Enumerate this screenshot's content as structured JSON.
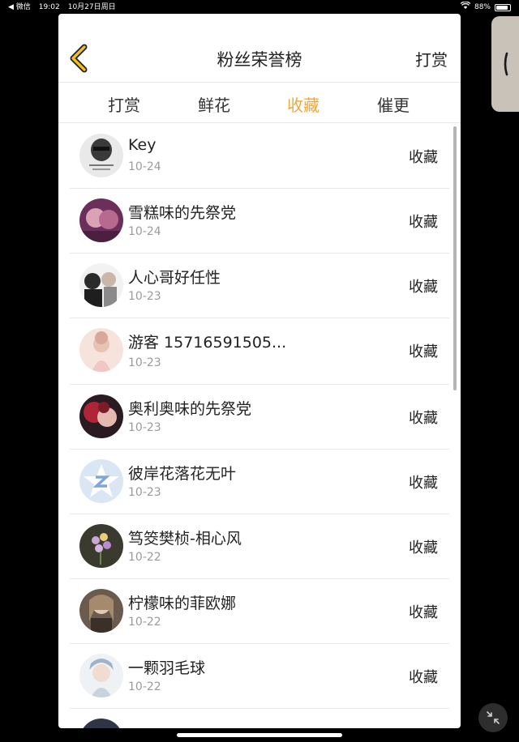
{
  "status_bar": {
    "back_app": "◀ 微信",
    "time": "19:02",
    "date": "10月27日周日",
    "battery": "88%",
    "battery_level": 0.88
  },
  "header": {
    "title": "粉丝荣誉榜",
    "action": "打赏",
    "back_icon": "chevron-left-icon"
  },
  "tabs": [
    {
      "label": "打赏",
      "active": false
    },
    {
      "label": "鲜花",
      "active": false
    },
    {
      "label": "收藏",
      "active": true
    },
    {
      "label": "催更",
      "active": false
    }
  ],
  "colors": {
    "accent": "#f2a63a",
    "text": "#222222",
    "muted": "#9b9b9b"
  },
  "fans": [
    {
      "name": "Key",
      "date": "10-24",
      "action": "收藏"
    },
    {
      "name": "雪糕味的先祭党",
      "date": "10-24",
      "action": "收藏"
    },
    {
      "name": "人心哥好任性",
      "date": "10-23",
      "action": "收藏"
    },
    {
      "name": "游客 15716591505...",
      "date": "10-23",
      "action": "收藏"
    },
    {
      "name": "奥利奥味的先祭党",
      "date": "10-23",
      "action": "收藏"
    },
    {
      "name": "彼岸花落花无叶",
      "date": "10-23",
      "action": "收藏"
    },
    {
      "name": "笃筊樊桢-相心风",
      "date": "10-22",
      "action": "收藏"
    },
    {
      "name": "柠檬味的菲欧娜",
      "date": "10-22",
      "action": "收藏"
    },
    {
      "name": "一颗羽毛球",
      "date": "10-22",
      "action": "收藏"
    }
  ]
}
